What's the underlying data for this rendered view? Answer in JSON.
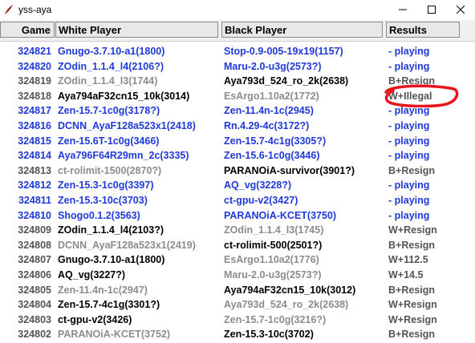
{
  "window": {
    "title": "yss-aya",
    "app_icon": "tk-feather-icon",
    "controls": [
      "minimize-icon",
      "maximize-icon",
      "close-icon"
    ]
  },
  "table": {
    "headers": {
      "game": "Game",
      "white": "White Player",
      "black": "Black Player",
      "results": "Results"
    },
    "rows": [
      {
        "game": "324821",
        "white": "Gnugo-3.7.10-a1(1800)",
        "black": "Stop-0.9-005-19x19(1157)",
        "result": "- playing",
        "colors": [
          "#1f3ad9",
          "#1f3ad9",
          "#1f3ad9",
          "#1f3ad9"
        ]
      },
      {
        "game": "324820",
        "white": "ZOdin_1.1.4_l4(2106?)",
        "black": "Maru-2.0-u3g(2573?)",
        "result": "- playing",
        "colors": [
          "#1f3ad9",
          "#1f3ad9",
          "#1f3ad9",
          "#1f3ad9"
        ]
      },
      {
        "game": "324819",
        "white": "ZOdin_1.1.4_l3(1744)",
        "black": "Aya793d_524_ro_2k(2638)",
        "result": "B+Resign",
        "colors": [
          "#555555",
          "#8c8c8c",
          "#000000",
          "#555555"
        ]
      },
      {
        "game": "324818",
        "white": "Aya794aF32cn15_10k(3014)",
        "black": "EsArgo1.10a2(1772)",
        "result": "W+Illegal",
        "colors": [
          "#555555",
          "#000000",
          "#8c8c8c",
          "#555555"
        ]
      },
      {
        "game": "324817",
        "white": "Zen-15.7-1c0g(3178?)",
        "black": "Zen-11.4n-1c(2945)",
        "result": "- playing",
        "colors": [
          "#1f3ad9",
          "#1f3ad9",
          "#1f3ad9",
          "#1f3ad9"
        ]
      },
      {
        "game": "324816",
        "white": "DCNN_AyaF128a523x1(2418)",
        "black": "Rn.4.29-4c(3172?)",
        "result": "- playing",
        "colors": [
          "#1f3ad9",
          "#1f3ad9",
          "#1f3ad9",
          "#1f3ad9"
        ]
      },
      {
        "game": "324815",
        "white": "Zen-15.6T-1c0g(3466)",
        "black": "Zen-15.7-4c1g(3305?)",
        "result": "- playing",
        "colors": [
          "#1f3ad9",
          "#1f3ad9",
          "#1f3ad9",
          "#1f3ad9"
        ]
      },
      {
        "game": "324814",
        "white": "Aya796F64R29mn_2c(3335)",
        "black": "Zen-15.6-1c0g(3446)",
        "result": "- playing",
        "colors": [
          "#1f3ad9",
          "#1f3ad9",
          "#1f3ad9",
          "#1f3ad9"
        ]
      },
      {
        "game": "324813",
        "white": "ct-rolimit-1500(2870?)",
        "black": "PARANOiA-survivor(3901?)",
        "result": "B+Resign",
        "colors": [
          "#555555",
          "#8c8c8c",
          "#000000",
          "#555555"
        ]
      },
      {
        "game": "324812",
        "white": "Zen-15.3-1c0g(3397)",
        "black": "AQ_vg(3228?)",
        "result": "- playing",
        "colors": [
          "#1f3ad9",
          "#1f3ad9",
          "#1f3ad9",
          "#1f3ad9"
        ]
      },
      {
        "game": "324811",
        "white": "Zen-15.3-10c(3703)",
        "black": "ct-gpu-v2(3427)",
        "result": "- playing",
        "colors": [
          "#1f3ad9",
          "#1f3ad9",
          "#1f3ad9",
          "#1f3ad9"
        ]
      },
      {
        "game": "324810",
        "white": "Shogo0.1.2(3563)",
        "black": "PARANOiA-KCET(3750)",
        "result": "- playing",
        "colors": [
          "#1f3ad9",
          "#1f3ad9",
          "#1f3ad9",
          "#1f3ad9"
        ]
      },
      {
        "game": "324809",
        "white": "ZOdin_1.1.4_l4(2103?)",
        "black": "ZOdin_1.1.4_l3(1745)",
        "result": "W+Resign",
        "colors": [
          "#555555",
          "#000000",
          "#8c8c8c",
          "#555555"
        ]
      },
      {
        "game": "324808",
        "white": "DCNN_AyaF128a523x1(2419)",
        "black": "ct-rolimit-500(2501?)",
        "result": "B+Resign",
        "colors": [
          "#555555",
          "#8c8c8c",
          "#000000",
          "#555555"
        ]
      },
      {
        "game": "324807",
        "white": "Gnugo-3.7.10-a1(1800)",
        "black": "EsArgo1.10a2(1776)",
        "result": "W+112.5",
        "colors": [
          "#555555",
          "#000000",
          "#8c8c8c",
          "#555555"
        ]
      },
      {
        "game": "324806",
        "white": "AQ_vg(3227?)",
        "black": "Maru-2.0-u3g(2573?)",
        "result": "W+14.5",
        "colors": [
          "#555555",
          "#000000",
          "#8c8c8c",
          "#555555"
        ]
      },
      {
        "game": "324805",
        "white": "Zen-11.4n-1c(2947)",
        "black": "Aya794aF32cn15_10k(3012)",
        "result": "B+Resign",
        "colors": [
          "#555555",
          "#8c8c8c",
          "#000000",
          "#555555"
        ]
      },
      {
        "game": "324804",
        "white": "Zen-15.7-4c1g(3301?)",
        "black": "Aya793d_524_ro_2k(2638)",
        "result": "W+Resign",
        "colors": [
          "#555555",
          "#000000",
          "#8c8c8c",
          "#555555"
        ]
      },
      {
        "game": "324803",
        "white": "ct-gpu-v2(3426)",
        "black": "Zen-15.7-1c0g(3216?)",
        "result": "W+Resign",
        "colors": [
          "#555555",
          "#000000",
          "#8c8c8c",
          "#555555"
        ]
      },
      {
        "game": "324802",
        "white": "PARANOiA-KCET(3752)",
        "black": "Zen-15.3-10c(3702)",
        "result": "B+Resign",
        "colors": [
          "#555555",
          "#8c8c8c",
          "#000000",
          "#555555"
        ]
      }
    ]
  },
  "annotation": {
    "color": "#e8141c",
    "target": "W+Illegal"
  }
}
